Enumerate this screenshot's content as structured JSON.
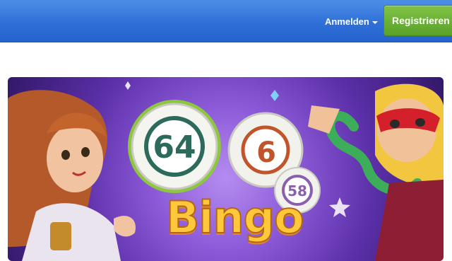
{
  "header": {
    "login_label": "Anmelden",
    "register_label": "Registrieren"
  },
  "banner": {
    "logo_text": "Bingo",
    "balls": [
      "64",
      "6",
      "58"
    ]
  },
  "icons": {
    "login_dropdown": "caret-down-icon"
  },
  "colors": {
    "header_blue": "#2f6fd8",
    "register_green": "#5ba22a",
    "banner_purple": "#8c5ad8"
  }
}
